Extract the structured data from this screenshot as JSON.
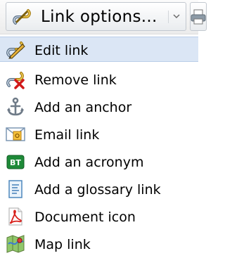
{
  "toolbar": {
    "link_options_label": "Link options...",
    "link_options_icon": "chain-link-icon",
    "dropdown_icon": "chevron-down-icon",
    "print_icon": "printer-icon"
  },
  "menu": {
    "items": [
      {
        "label": "Edit link",
        "icon": "pencil-link-icon",
        "highlighted": true
      },
      {
        "label": "Remove link",
        "icon": "remove-link-icon"
      },
      {
        "label": "Add an anchor",
        "icon": "anchor-icon"
      },
      {
        "label": "Email link",
        "icon": "email-icon"
      },
      {
        "label": "Add an acronym",
        "icon": "acronym-bt-icon",
        "icon_text": "BT"
      },
      {
        "label": "Add a glossary link",
        "icon": "glossary-icon"
      },
      {
        "label": "Document icon",
        "icon": "pdf-document-icon"
      },
      {
        "label": "Map link",
        "icon": "map-icon"
      }
    ]
  },
  "colors": {
    "highlight_bg": "#dbe6f5",
    "highlight_border": "#b9cde8"
  }
}
